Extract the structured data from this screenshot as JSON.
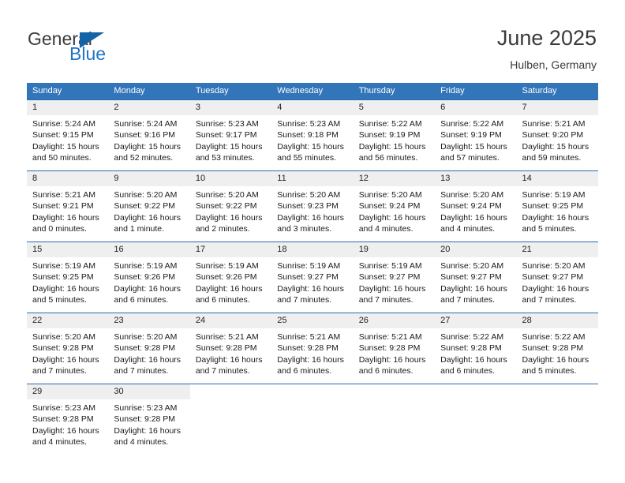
{
  "logo": {
    "part1": "General",
    "part2": "Blue",
    "triangle_color": "#1464a5",
    "blue_color": "#1f76c2"
  },
  "header": {
    "title": "June 2025",
    "subtitle": "Hulben, Germany"
  },
  "theme": {
    "header_bg": "#3275b9",
    "row_border": "#2a6bad",
    "daynum_bg": "#efefef"
  },
  "weekdays": [
    "Sunday",
    "Monday",
    "Tuesday",
    "Wednesday",
    "Thursday",
    "Friday",
    "Saturday"
  ],
  "weeks": [
    [
      {
        "day": "1",
        "sunrise": "Sunrise: 5:24 AM",
        "sunset": "Sunset: 9:15 PM",
        "daylight": "Daylight: 15 hours and 50 minutes."
      },
      {
        "day": "2",
        "sunrise": "Sunrise: 5:24 AM",
        "sunset": "Sunset: 9:16 PM",
        "daylight": "Daylight: 15 hours and 52 minutes."
      },
      {
        "day": "3",
        "sunrise": "Sunrise: 5:23 AM",
        "sunset": "Sunset: 9:17 PM",
        "daylight": "Daylight: 15 hours and 53 minutes."
      },
      {
        "day": "4",
        "sunrise": "Sunrise: 5:23 AM",
        "sunset": "Sunset: 9:18 PM",
        "daylight": "Daylight: 15 hours and 55 minutes."
      },
      {
        "day": "5",
        "sunrise": "Sunrise: 5:22 AM",
        "sunset": "Sunset: 9:19 PM",
        "daylight": "Daylight: 15 hours and 56 minutes."
      },
      {
        "day": "6",
        "sunrise": "Sunrise: 5:22 AM",
        "sunset": "Sunset: 9:19 PM",
        "daylight": "Daylight: 15 hours and 57 minutes."
      },
      {
        "day": "7",
        "sunrise": "Sunrise: 5:21 AM",
        "sunset": "Sunset: 9:20 PM",
        "daylight": "Daylight: 15 hours and 59 minutes."
      }
    ],
    [
      {
        "day": "8",
        "sunrise": "Sunrise: 5:21 AM",
        "sunset": "Sunset: 9:21 PM",
        "daylight": "Daylight: 16 hours and 0 minutes."
      },
      {
        "day": "9",
        "sunrise": "Sunrise: 5:20 AM",
        "sunset": "Sunset: 9:22 PM",
        "daylight": "Daylight: 16 hours and 1 minute."
      },
      {
        "day": "10",
        "sunrise": "Sunrise: 5:20 AM",
        "sunset": "Sunset: 9:22 PM",
        "daylight": "Daylight: 16 hours and 2 minutes."
      },
      {
        "day": "11",
        "sunrise": "Sunrise: 5:20 AM",
        "sunset": "Sunset: 9:23 PM",
        "daylight": "Daylight: 16 hours and 3 minutes."
      },
      {
        "day": "12",
        "sunrise": "Sunrise: 5:20 AM",
        "sunset": "Sunset: 9:24 PM",
        "daylight": "Daylight: 16 hours and 4 minutes."
      },
      {
        "day": "13",
        "sunrise": "Sunrise: 5:20 AM",
        "sunset": "Sunset: 9:24 PM",
        "daylight": "Daylight: 16 hours and 4 minutes."
      },
      {
        "day": "14",
        "sunrise": "Sunrise: 5:19 AM",
        "sunset": "Sunset: 9:25 PM",
        "daylight": "Daylight: 16 hours and 5 minutes."
      }
    ],
    [
      {
        "day": "15",
        "sunrise": "Sunrise: 5:19 AM",
        "sunset": "Sunset: 9:25 PM",
        "daylight": "Daylight: 16 hours and 5 minutes."
      },
      {
        "day": "16",
        "sunrise": "Sunrise: 5:19 AM",
        "sunset": "Sunset: 9:26 PM",
        "daylight": "Daylight: 16 hours and 6 minutes."
      },
      {
        "day": "17",
        "sunrise": "Sunrise: 5:19 AM",
        "sunset": "Sunset: 9:26 PM",
        "daylight": "Daylight: 16 hours and 6 minutes."
      },
      {
        "day": "18",
        "sunrise": "Sunrise: 5:19 AM",
        "sunset": "Sunset: 9:27 PM",
        "daylight": "Daylight: 16 hours and 7 minutes."
      },
      {
        "day": "19",
        "sunrise": "Sunrise: 5:19 AM",
        "sunset": "Sunset: 9:27 PM",
        "daylight": "Daylight: 16 hours and 7 minutes."
      },
      {
        "day": "20",
        "sunrise": "Sunrise: 5:20 AM",
        "sunset": "Sunset: 9:27 PM",
        "daylight": "Daylight: 16 hours and 7 minutes."
      },
      {
        "day": "21",
        "sunrise": "Sunrise: 5:20 AM",
        "sunset": "Sunset: 9:27 PM",
        "daylight": "Daylight: 16 hours and 7 minutes."
      }
    ],
    [
      {
        "day": "22",
        "sunrise": "Sunrise: 5:20 AM",
        "sunset": "Sunset: 9:28 PM",
        "daylight": "Daylight: 16 hours and 7 minutes."
      },
      {
        "day": "23",
        "sunrise": "Sunrise: 5:20 AM",
        "sunset": "Sunset: 9:28 PM",
        "daylight": "Daylight: 16 hours and 7 minutes."
      },
      {
        "day": "24",
        "sunrise": "Sunrise: 5:21 AM",
        "sunset": "Sunset: 9:28 PM",
        "daylight": "Daylight: 16 hours and 7 minutes."
      },
      {
        "day": "25",
        "sunrise": "Sunrise: 5:21 AM",
        "sunset": "Sunset: 9:28 PM",
        "daylight": "Daylight: 16 hours and 6 minutes."
      },
      {
        "day": "26",
        "sunrise": "Sunrise: 5:21 AM",
        "sunset": "Sunset: 9:28 PM",
        "daylight": "Daylight: 16 hours and 6 minutes."
      },
      {
        "day": "27",
        "sunrise": "Sunrise: 5:22 AM",
        "sunset": "Sunset: 9:28 PM",
        "daylight": "Daylight: 16 hours and 6 minutes."
      },
      {
        "day": "28",
        "sunrise": "Sunrise: 5:22 AM",
        "sunset": "Sunset: 9:28 PM",
        "daylight": "Daylight: 16 hours and 5 minutes."
      }
    ],
    [
      {
        "day": "29",
        "sunrise": "Sunrise: 5:23 AM",
        "sunset": "Sunset: 9:28 PM",
        "daylight": "Daylight: 16 hours and 4 minutes."
      },
      {
        "day": "30",
        "sunrise": "Sunrise: 5:23 AM",
        "sunset": "Sunset: 9:28 PM",
        "daylight": "Daylight: 16 hours and 4 minutes."
      },
      null,
      null,
      null,
      null,
      null
    ]
  ]
}
